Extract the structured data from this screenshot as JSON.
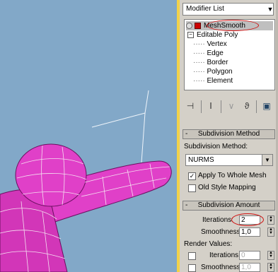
{
  "viewport": {
    "background": "#82a8c8",
    "mesh_color": "#e040c8"
  },
  "modifier_list": {
    "label": "Modifier List"
  },
  "stack": {
    "items": [
      {
        "label": "MeshSmooth",
        "selected": true
      },
      {
        "label": "Editable Poly"
      },
      {
        "label": "Vertex"
      },
      {
        "label": "Edge"
      },
      {
        "label": "Border"
      },
      {
        "label": "Polygon"
      },
      {
        "label": "Element"
      }
    ]
  },
  "toolbar": {
    "icons": [
      "pin-stack-icon",
      "show-end-result-icon",
      "make-unique-icon",
      "remove-modifier-icon",
      "configure-sets-icon"
    ]
  },
  "subdivision_method": {
    "title": "Subdivision Method",
    "minus": "-",
    "method_label": "Subdivision Method:",
    "method_value": "NURMS",
    "apply_whole_mesh": {
      "label": "Apply To Whole Mesh",
      "checked": true
    },
    "old_style": {
      "label": "Old Style Mapping",
      "checked": false
    }
  },
  "subdivision_amount": {
    "title": "Subdivision Amount",
    "minus": "-",
    "iterations_label": "Iterations:",
    "iterations_value": "2",
    "smoothness_label": "Smoothness:",
    "smoothness_value": "1,0",
    "render_values_label": "Render Values:",
    "render_iterations_label": "Iterations:",
    "render_iterations_value": "0",
    "render_smoothness_label": "Smoothness:",
    "render_smoothness_value": "1,0"
  },
  "accent": "#d01010"
}
